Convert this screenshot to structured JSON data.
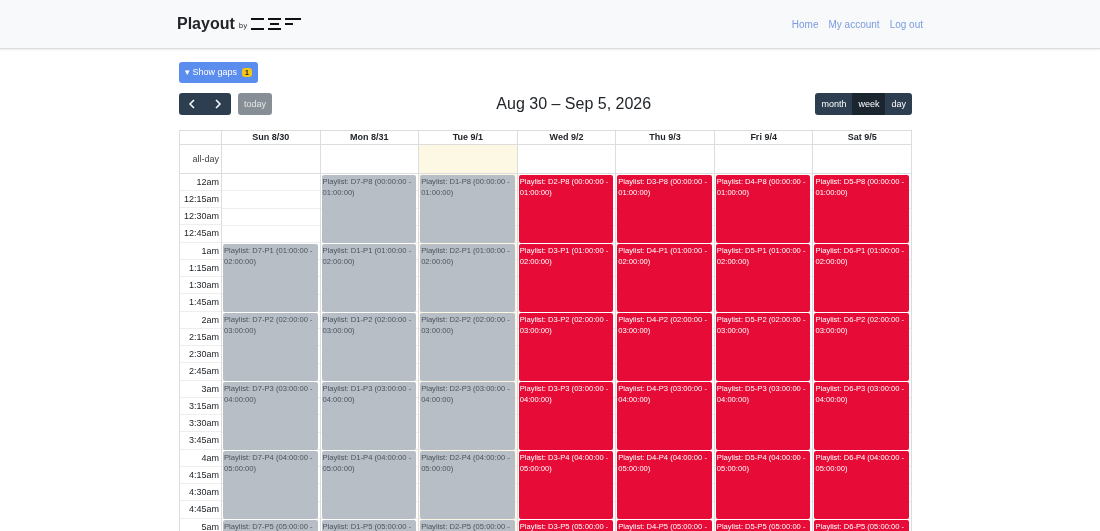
{
  "header": {
    "brand": "Playout",
    "by": "by",
    "nav": [
      "Home",
      "My account",
      "Log out"
    ]
  },
  "gaps_button": {
    "caret": "▾",
    "label": "Show gaps",
    "count": "1"
  },
  "toolbar": {
    "today": "today",
    "title": "Aug 30 – Sep 5, 2026",
    "views": [
      {
        "label": "month",
        "selected": false
      },
      {
        "label": "week",
        "selected": true
      },
      {
        "label": "day",
        "selected": false
      }
    ]
  },
  "calendar": {
    "all_day_label": "all-day",
    "time_slots": [
      "12am",
      "12:15am",
      "12:30am",
      "12:45am",
      "1am",
      "1:15am",
      "1:30am",
      "1:45am",
      "2am",
      "2:15am",
      "2:30am",
      "2:45am",
      "3am",
      "3:15am",
      "3:30am",
      "3:45am",
      "4am",
      "4:15am",
      "4:30am",
      "4:45am",
      "5am"
    ],
    "days": [
      {
        "label": "Sun 8/30",
        "today": false,
        "hours": [
          {
            "kind": "empty"
          },
          {
            "kind": "past",
            "text": "Playlist: D7-P1 (01:00:00 - 02:00:00)"
          },
          {
            "kind": "past",
            "text": "Playlist: D7-P2 (02:00:00 - 03:00:00)"
          },
          {
            "kind": "past",
            "text": "Playlist: D7-P3 (03:00:00 - 04:00:00)"
          },
          {
            "kind": "past",
            "text": "Playlist: D7-P4 (04:00:00 - 05:00:00)"
          },
          {
            "kind": "past",
            "text": "Playlist: D7-P5 (05:00:00 -"
          }
        ]
      },
      {
        "label": "Mon 8/31",
        "today": false,
        "hours": [
          {
            "kind": "past",
            "text": "Playlist: D7-P8 (00:00:00 - 01:00:00)"
          },
          {
            "kind": "past",
            "text": "Playlist: D1-P1 (01:00:00 - 02:00:00)"
          },
          {
            "kind": "past",
            "text": "Playlist: D1-P2 (02:00:00 - 03:00:00)"
          },
          {
            "kind": "past",
            "text": "Playlist: D1-P3 (03:00:00 - 04:00:00)"
          },
          {
            "kind": "past",
            "text": "Playlist: D1-P4 (04:00:00 - 05:00:00)"
          },
          {
            "kind": "past",
            "text": "Playlist: D1-P5 (05:00:00 -"
          }
        ]
      },
      {
        "label": "Tue 9/1",
        "today": true,
        "hours": [
          {
            "kind": "past",
            "text": "Playlist: D1-P8 (00:00:00 - 01:00:00)"
          },
          {
            "kind": "past",
            "text": "Playlist: D2-P1 (01:00:00 - 02:00:00)"
          },
          {
            "kind": "past",
            "text": "Playlist: D2-P2 (02:00:00 - 03:00:00)"
          },
          {
            "kind": "past",
            "text": "Playlist: D2-P3 (03:00:00 - 04:00:00)"
          },
          {
            "kind": "past",
            "text": "Playlist: D2-P4 (04:00:00 - 05:00:00)"
          },
          {
            "kind": "past",
            "text": "Playlist: D2-P5 (05:00:00 -"
          }
        ]
      },
      {
        "label": "Wed 9/2",
        "today": false,
        "hours": [
          {
            "kind": "upcoming",
            "text": "Playlist: D2-P8 (00:00:00 - 01:00:00)"
          },
          {
            "kind": "upcoming",
            "text": "Playlist: D3-P1 (01:00:00 - 02:00:00)"
          },
          {
            "kind": "upcoming",
            "text": "Playlist: D3-P2 (02:00:00 - 03:00:00)"
          },
          {
            "kind": "upcoming",
            "text": "Playlist: D3-P3 (03:00:00 - 04:00:00)"
          },
          {
            "kind": "upcoming",
            "text": "Playlist: D3-P4 (04:00:00 - 05:00:00)"
          },
          {
            "kind": "upcoming",
            "text": "Playlist: D3-P5 (05:00:00 -"
          }
        ]
      },
      {
        "label": "Thu 9/3",
        "today": false,
        "hours": [
          {
            "kind": "upcoming",
            "text": "Playlist: D3-P8 (00:00:00 - 01:00:00)"
          },
          {
            "kind": "upcoming",
            "text": "Playlist: D4-P1 (01:00:00 - 02:00:00)"
          },
          {
            "kind": "upcoming",
            "text": "Playlist: D4-P2 (02:00:00 - 03:00:00)"
          },
          {
            "kind": "upcoming",
            "text": "Playlist: D4-P3 (03:00:00 - 04:00:00)"
          },
          {
            "kind": "upcoming",
            "text": "Playlist: D4-P4 (04:00:00 - 05:00:00)"
          },
          {
            "kind": "upcoming",
            "text": "Playlist: D4-P5 (05:00:00 -"
          }
        ]
      },
      {
        "label": "Fri 9/4",
        "today": false,
        "hours": [
          {
            "kind": "upcoming",
            "text": "Playlist: D4-P8 (00:00:00 - 01:00:00)"
          },
          {
            "kind": "upcoming",
            "text": "Playlist: D5-P1 (01:00:00 - 02:00:00)"
          },
          {
            "kind": "upcoming",
            "text": "Playlist: D5-P2 (02:00:00 - 03:00:00)"
          },
          {
            "kind": "upcoming",
            "text": "Playlist: D5-P3 (03:00:00 - 04:00:00)"
          },
          {
            "kind": "upcoming",
            "text": "Playlist: D5-P4 (04:00:00 - 05:00:00)"
          },
          {
            "kind": "upcoming",
            "text": "Playlist: D5-P5 (05:00:00 -"
          }
        ]
      },
      {
        "label": "Sat 9/5",
        "today": false,
        "hours": [
          {
            "kind": "upcoming",
            "text": "Playlist: D5-P8 (00:00:00 - 01:00:00)"
          },
          {
            "kind": "upcoming",
            "text": "Playlist: D6-P1 (01:00:00 - 02:00:00)"
          },
          {
            "kind": "upcoming",
            "text": "Playlist: D6-P2 (02:00:00 - 03:00:00)"
          },
          {
            "kind": "upcoming",
            "text": "Playlist: D6-P3 (03:00:00 - 04:00:00)"
          },
          {
            "kind": "upcoming",
            "text": "Playlist: D6-P4 (04:00:00 - 05:00:00)"
          },
          {
            "kind": "upcoming",
            "text": "Playlist: D6-P5 (05:00:00 -"
          }
        ]
      }
    ]
  }
}
